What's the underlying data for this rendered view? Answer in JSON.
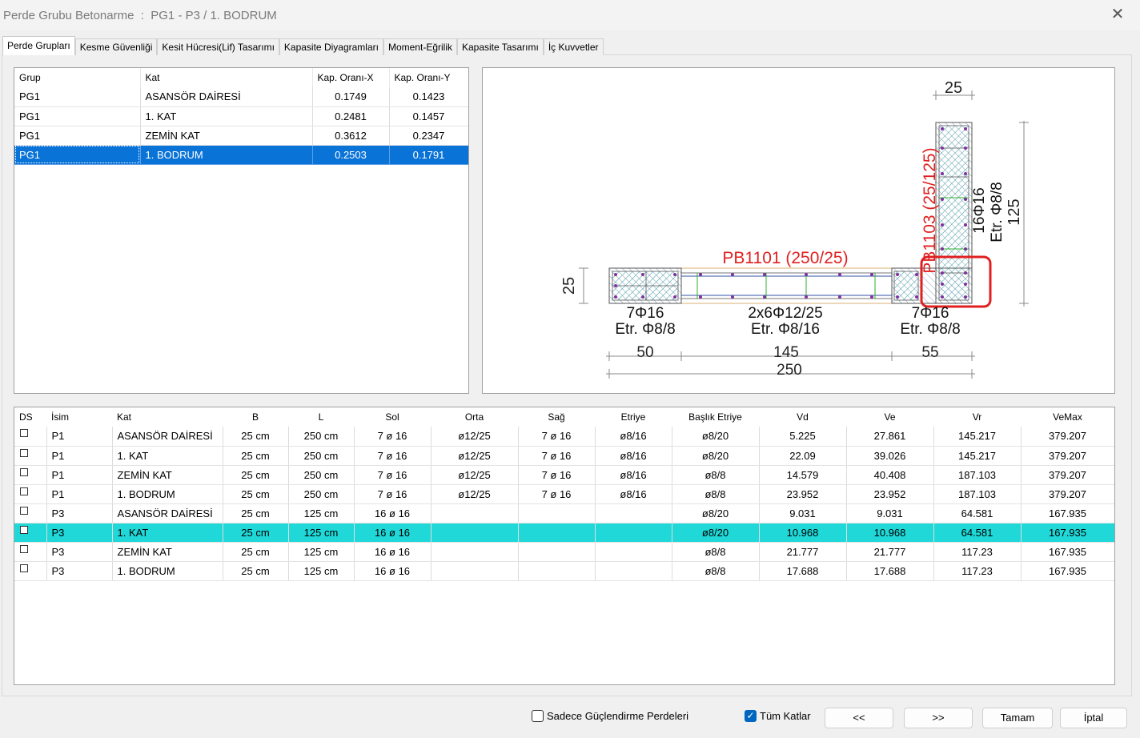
{
  "window": {
    "title": "Perde Grubu Betonarme  :  PG1 - P3 / 1. BODRUM"
  },
  "tabs": [
    "Perde Grupları",
    "Kesme Güvenliği",
    "Kesit Hücresi(Lif) Tasarımı",
    "Kapasite Diyagramları",
    "Moment-Eğrilik",
    "Kapasite Tasarımı",
    "İç Kuvvetler"
  ],
  "groups": {
    "headers": [
      "Grup",
      "Kat",
      "Kap. Oranı-X",
      "Kap. Oranı-Y"
    ],
    "rows": [
      [
        "PG1",
        "ASANSÖR DAİRESİ",
        "0.1749",
        "0.1423"
      ],
      [
        "PG1",
        "1. KAT",
        "0.2481",
        "0.1457"
      ],
      [
        "PG1",
        "ZEMİN KAT",
        "0.3612",
        "0.2347"
      ],
      [
        "PG1",
        "1. BODRUM",
        "0.2503",
        "0.1791"
      ]
    ]
  },
  "drawing": {
    "wall1_label": "PB1101 (250/25)",
    "wall2_label": "PB1103 (25/125)",
    "dim_top": "25",
    "dim_left": "25",
    "dim_right": "125",
    "left_end_bars": "7Φ16",
    "left_end_stirrup": "Etr. Φ8/8",
    "mid_bars": "2x6Φ12/25",
    "mid_stirrup": "Etr. Φ8/16",
    "right_end_bars": "7Φ16",
    "right_end_stirrup": "Etr. Φ8/8",
    "vert_bars": "16Φ16",
    "vert_stirrup": "Etr. Φ8/8",
    "dim_50": "50",
    "dim_145": "145",
    "dim_55": "55",
    "dim_250": "250",
    "highlight_color": "#e02020",
    "label_color": "#e02020"
  },
  "walls": {
    "headers": [
      "DS",
      "İsim",
      "Kat",
      "B",
      "L",
      "Sol",
      "Orta",
      "Sağ",
      "Etriye",
      "Başlık Etriye",
      "Vd",
      "Ve",
      "Vr",
      "VeMax"
    ],
    "rows": [
      [
        "P1",
        "ASANSÖR DAİRESİ",
        "25 cm",
        "250 cm",
        "7 ø 16",
        "ø12/25",
        "7 ø 16",
        "ø8/16",
        "ø8/20",
        "5.225",
        "27.861",
        "145.217",
        "379.207"
      ],
      [
        "P1",
        "1. KAT",
        "25 cm",
        "250 cm",
        "7 ø 16",
        "ø12/25",
        "7 ø 16",
        "ø8/16",
        "ø8/20",
        "22.09",
        "39.026",
        "145.217",
        "379.207"
      ],
      [
        "P1",
        "ZEMİN KAT",
        "25 cm",
        "250 cm",
        "7 ø 16",
        "ø12/25",
        "7 ø 16",
        "ø8/16",
        "ø8/8",
        "14.579",
        "40.408",
        "187.103",
        "379.207"
      ],
      [
        "P1",
        "1. BODRUM",
        "25 cm",
        "250 cm",
        "7 ø 16",
        "ø12/25",
        "7 ø 16",
        "ø8/16",
        "ø8/8",
        "23.952",
        "23.952",
        "187.103",
        "379.207"
      ],
      [
        "P3",
        "ASANSÖR DAİRESİ",
        "25 cm",
        "125 cm",
        "16 ø 16",
        "",
        "",
        "",
        "ø8/20",
        "9.031",
        "9.031",
        "64.581",
        "167.935"
      ],
      [
        "P3",
        "1. KAT",
        "25 cm",
        "125 cm",
        "16 ø 16",
        "",
        "",
        "",
        "ø8/20",
        "10.968",
        "10.968",
        "64.581",
        "167.935"
      ],
      [
        "P3",
        "ZEMİN KAT",
        "25 cm",
        "125 cm",
        "16 ø 16",
        "",
        "",
        "",
        "ø8/8",
        "21.777",
        "21.777",
        "117.23",
        "167.935"
      ],
      [
        "P3",
        "1. BODRUM",
        "25 cm",
        "125 cm",
        "16 ø 16",
        "",
        "",
        "",
        "ø8/8",
        "17.688",
        "17.688",
        "117.23",
        "167.935"
      ]
    ]
  },
  "footer": {
    "only_strengthening_label": "Sadece Güçlendirme Perdeleri",
    "all_floors_label": "Tüm Katlar",
    "prev_label": "<<",
    "next_label": ">>",
    "ok_label": "Tamam",
    "cancel_label": "İptal"
  }
}
